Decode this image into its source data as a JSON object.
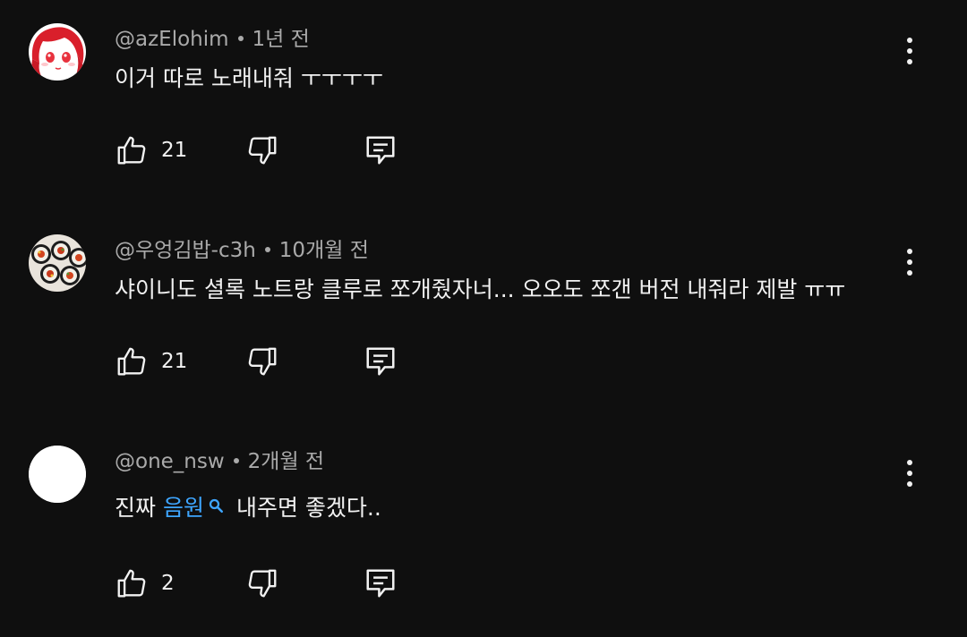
{
  "comments": [
    {
      "handle": "@azElohim",
      "time": "1년 전",
      "text_before": "이거 따로 노래내줘 ㅜㅜㅜㅜ",
      "text_link": "",
      "text_after": "",
      "likes": "21",
      "avatar_icon": "anime-girl-avatar"
    },
    {
      "handle": "@우엉김밥-c3h",
      "time": "10개월 전",
      "text_before": "샤이니도 셜록 노트랑 클루로 쪼개줬자너... 오오도 쪼갠 버전 내줘라 제발 ㅠㅠ",
      "text_link": "",
      "text_after": "",
      "likes": "21",
      "avatar_icon": "kimbap-avatar"
    },
    {
      "handle": "@one_nsw",
      "time": "2개월 전",
      "text_before": "진짜 ",
      "text_link": "음원",
      "text_after": "내주면 좋겠다..",
      "likes": "2",
      "avatar_icon": "blank-white-avatar"
    }
  ],
  "colors": {
    "background": "#0f0f0f",
    "text": "#f1f1f1",
    "meta": "#aaaaaa",
    "link": "#3ea6ff"
  }
}
